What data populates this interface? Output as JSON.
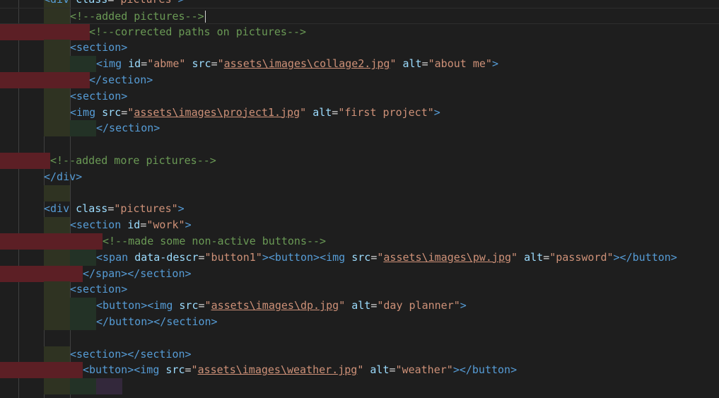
{
  "editor": {
    "language": "html",
    "lines": [
      {
        "segments": [
          {
            "t": "<div ",
            "c": "tk-tag"
          },
          {
            "t": "class",
            "c": "tk-attr"
          },
          {
            "t": "=",
            "c": ""
          },
          {
            "t": "\"pictures\"",
            "c": "tk-val"
          },
          {
            "t": ">",
            "c": "tk-tag"
          }
        ]
      },
      {
        "segments": [
          {
            "t": "<!--added pictures-->",
            "c": "tk-comment"
          }
        ]
      },
      {
        "segments": [
          {
            "t": "<!--corrected paths on pictures-->",
            "c": "tk-comment"
          }
        ]
      },
      {
        "segments": [
          {
            "t": "<section>",
            "c": "tk-tag"
          }
        ]
      },
      {
        "segments": [
          {
            "t": "<img ",
            "c": "tk-tag"
          },
          {
            "t": "id",
            "c": "tk-attr"
          },
          {
            "t": "=",
            "c": ""
          },
          {
            "t": "\"abme\"",
            "c": "tk-val"
          },
          {
            "t": " ",
            "c": ""
          },
          {
            "t": "src",
            "c": "tk-attr"
          },
          {
            "t": "=",
            "c": ""
          },
          {
            "t": "\"",
            "c": "tk-val"
          },
          {
            "t": "assets\\images\\collage2.jpg",
            "c": "tk-link"
          },
          {
            "t": "\"",
            "c": "tk-val"
          },
          {
            "t": " ",
            "c": ""
          },
          {
            "t": "alt",
            "c": "tk-attr"
          },
          {
            "t": "=",
            "c": ""
          },
          {
            "t": "\"about me\"",
            "c": "tk-val"
          },
          {
            "t": ">",
            "c": "tk-tag"
          }
        ]
      },
      {
        "segments": [
          {
            "t": "</section>",
            "c": "tk-tag"
          }
        ]
      },
      {
        "segments": [
          {
            "t": "<section>",
            "c": "tk-tag"
          }
        ]
      },
      {
        "segments": [
          {
            "t": "<img ",
            "c": "tk-tag"
          },
          {
            "t": "src",
            "c": "tk-attr"
          },
          {
            "t": "=",
            "c": ""
          },
          {
            "t": "\"",
            "c": "tk-val"
          },
          {
            "t": "assets\\images\\project1.jpg",
            "c": "tk-link"
          },
          {
            "t": "\"",
            "c": "tk-val"
          },
          {
            "t": " ",
            "c": ""
          },
          {
            "t": "alt",
            "c": "tk-attr"
          },
          {
            "t": "=",
            "c": ""
          },
          {
            "t": "\"first project\"",
            "c": "tk-val"
          },
          {
            "t": ">",
            "c": "tk-tag"
          }
        ]
      },
      {
        "segments": [
          {
            "t": "</section>",
            "c": "tk-tag"
          }
        ]
      },
      {
        "segments": []
      },
      {
        "segments": [
          {
            "t": "<!--added more pictures-->",
            "c": "tk-comment"
          }
        ]
      },
      {
        "segments": [
          {
            "t": "</div>",
            "c": "tk-tag"
          }
        ]
      },
      {
        "segments": []
      },
      {
        "segments": [
          {
            "t": "<div ",
            "c": "tk-tag"
          },
          {
            "t": "class",
            "c": "tk-attr"
          },
          {
            "t": "=",
            "c": ""
          },
          {
            "t": "\"pictures\"",
            "c": "tk-val"
          },
          {
            "t": ">",
            "c": "tk-tag"
          }
        ]
      },
      {
        "segments": [
          {
            "t": "<section ",
            "c": "tk-tag"
          },
          {
            "t": "id",
            "c": "tk-attr"
          },
          {
            "t": "=",
            "c": ""
          },
          {
            "t": "\"work\"",
            "c": "tk-val"
          },
          {
            "t": ">",
            "c": "tk-tag"
          }
        ]
      },
      {
        "segments": [
          {
            "t": "<!--made some non-active buttons-->",
            "c": "tk-comment"
          }
        ]
      },
      {
        "segments": [
          {
            "t": "<span ",
            "c": "tk-tag"
          },
          {
            "t": "data-descr",
            "c": "tk-attr"
          },
          {
            "t": "=",
            "c": ""
          },
          {
            "t": "\"button1\"",
            "c": "tk-val"
          },
          {
            "t": "><button><img ",
            "c": "tk-tag"
          },
          {
            "t": "src",
            "c": "tk-attr"
          },
          {
            "t": "=",
            "c": ""
          },
          {
            "t": "\"",
            "c": "tk-val"
          },
          {
            "t": "assets\\images\\pw.jpg",
            "c": "tk-link"
          },
          {
            "t": "\"",
            "c": "tk-val"
          },
          {
            "t": " ",
            "c": ""
          },
          {
            "t": "alt",
            "c": "tk-attr"
          },
          {
            "t": "=",
            "c": ""
          },
          {
            "t": "\"password\"",
            "c": "tk-val"
          },
          {
            "t": "></button>",
            "c": "tk-tag"
          }
        ]
      },
      {
        "segments": [
          {
            "t": "</span></section>",
            "c": "tk-tag"
          }
        ]
      },
      {
        "segments": [
          {
            "t": "<section>",
            "c": "tk-tag"
          }
        ]
      },
      {
        "segments": [
          {
            "t": "<button><img ",
            "c": "tk-tag"
          },
          {
            "t": "src",
            "c": "tk-attr"
          },
          {
            "t": "=",
            "c": ""
          },
          {
            "t": "\"",
            "c": "tk-val"
          },
          {
            "t": "assets\\images\\dp.jpg",
            "c": "tk-link"
          },
          {
            "t": "\"",
            "c": "tk-val"
          },
          {
            "t": " ",
            "c": ""
          },
          {
            "t": "alt",
            "c": "tk-attr"
          },
          {
            "t": "=",
            "c": ""
          },
          {
            "t": "\"day planner\"",
            "c": "tk-val"
          },
          {
            "t": ">",
            "c": "tk-tag"
          }
        ]
      },
      {
        "segments": [
          {
            "t": "</button></section>",
            "c": "tk-tag"
          }
        ]
      },
      {
        "segments": []
      },
      {
        "segments": [
          {
            "t": "<section></section>",
            "c": "tk-tag"
          }
        ]
      },
      {
        "segments": [
          {
            "t": "<button><img ",
            "c": "tk-tag"
          },
          {
            "t": "src",
            "c": "tk-attr"
          },
          {
            "t": "=",
            "c": ""
          },
          {
            "t": "\"",
            "c": "tk-val"
          },
          {
            "t": "assets\\images\\weather.jpg",
            "c": "tk-link"
          },
          {
            "t": "\"",
            "c": "tk-val"
          },
          {
            "t": " ",
            "c": ""
          },
          {
            "t": "alt",
            "c": "tk-attr"
          },
          {
            "t": "=",
            "c": ""
          },
          {
            "t": "\"weather\"",
            "c": "tk-val"
          },
          {
            "t": "></button>",
            "c": "tk-tag"
          }
        ]
      },
      {
        "segments": []
      }
    ]
  },
  "colors": {
    "background": "#1e1e1e",
    "tag": "#569cd6",
    "attribute": "#9cdcfe",
    "string": "#ce9178",
    "comment": "#6a9955",
    "indent_error": "#5c1f25",
    "indent_yellow": "#2f3322",
    "indent_green": "#233226",
    "indent_purple": "#33283b"
  }
}
